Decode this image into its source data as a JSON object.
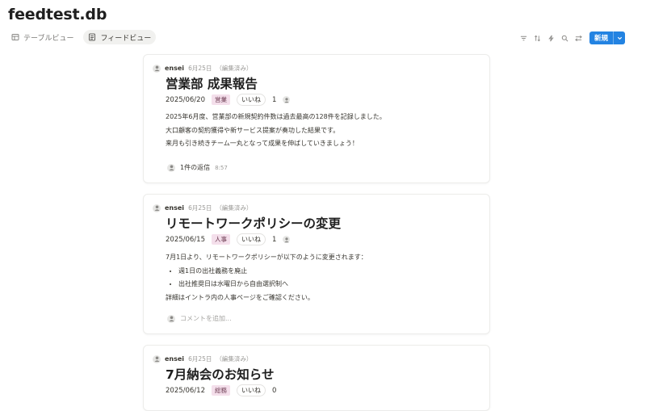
{
  "app": {
    "title": "feedtest.db"
  },
  "tabs": [
    {
      "label": "テーブルビュー",
      "icon": "table-icon",
      "active": false
    },
    {
      "label": "フィードビュー",
      "icon": "feed-icon",
      "active": true
    }
  ],
  "toolbar": {
    "icons": [
      "filter-icon",
      "sort-icon",
      "automation-icon",
      "search-icon",
      "settings-icon"
    ],
    "new_label": "新規"
  },
  "posts": [
    {
      "author": "ensei",
      "date_meta": "6月25日",
      "edited": "（編集済み）",
      "title": "営業部 成果報告",
      "date": "2025/06/20",
      "tag": "営業",
      "likes_label": "いいね",
      "likes_count": "1",
      "body": [
        "2025年6月度、営業部の新規契約件数は過去最高の128件を記録しました。",
        "大口顧客の契約獲得や新サービス提案が奏功した結果です。",
        "来月も引き続きチーム一丸となって成果を伸ばしていきましょう！"
      ],
      "reply_text": "1件の返信",
      "reply_time": "8:57"
    },
    {
      "author": "ensei",
      "date_meta": "6月25日",
      "edited": "（編集済み）",
      "title": "リモートワークポリシーの変更",
      "date": "2025/06/15",
      "tag": "人事",
      "likes_label": "いいね",
      "likes_count": "1",
      "intro": "7月1日より、リモートワークポリシーが以下のように変更されます：",
      "bullets": [
        "週1日の出社義務を廃止",
        "出社推奨日は水曜日から自由選択制へ"
      ],
      "outro": "詳細はイントラ内の人事ページをご確認ください。",
      "comment_placeholder": "コメントを追加..."
    },
    {
      "author": "ensei",
      "date_meta": "6月25日",
      "edited": "（編集済み）",
      "title": "7月納会のお知らせ",
      "date": "2025/06/12",
      "tag": "総務",
      "likes_label": "いいね",
      "likes_count": "0"
    }
  ]
}
